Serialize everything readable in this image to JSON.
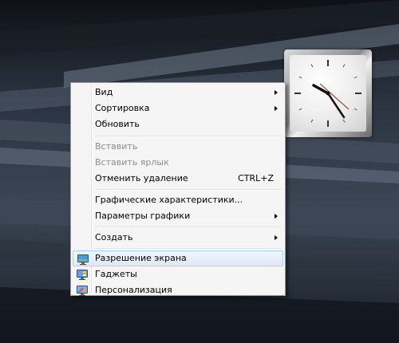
{
  "menu": {
    "items": [
      {
        "label": "Вид"
      },
      {
        "label": "Сортировка"
      },
      {
        "label": "Обновить"
      },
      {
        "label": "Вставить"
      },
      {
        "label": "Вставить ярлык"
      },
      {
        "label": "Отменить удаление",
        "shortcut": "CTRL+Z"
      },
      {
        "label": "Графические характеристики..."
      },
      {
        "label": "Параметры графики"
      },
      {
        "label": "Создать"
      },
      {
        "label": "Разрешение экрана",
        "icon": "monitor-icon"
      },
      {
        "label": "Гаджеты",
        "icon": "gadgets-icon"
      },
      {
        "label": "Персонализация",
        "icon": "personalize-icon"
      }
    ]
  },
  "clock": {
    "icon": "clock-gadget"
  },
  "colors": {
    "highlight": "#dde9f8",
    "disabled_text": "#8d8d8d",
    "desktop": "#1f2630"
  }
}
